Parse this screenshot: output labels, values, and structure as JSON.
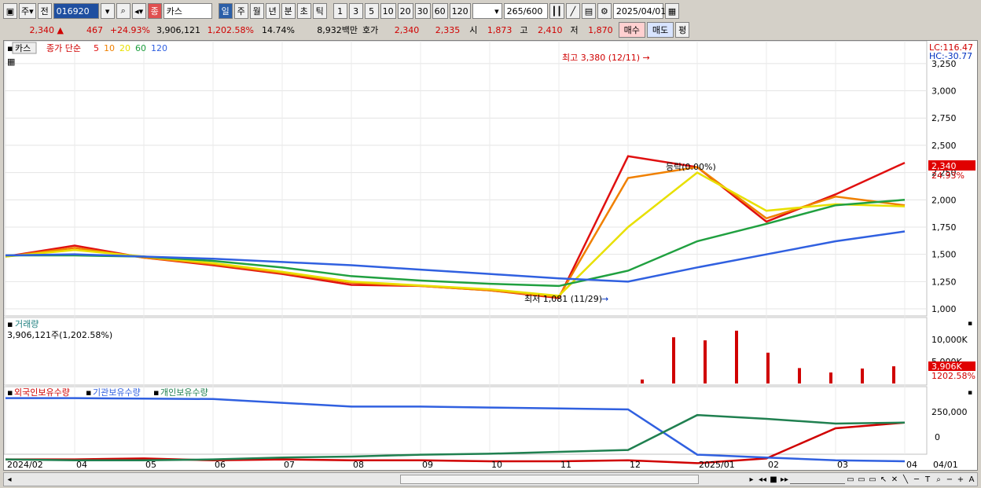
{
  "toolbar": {
    "menu1": "주",
    "menu2": "전",
    "code": "016920",
    "name_badge": "종",
    "name": "카스",
    "periods": [
      "일",
      "주",
      "월",
      "년",
      "분",
      "초",
      "틱"
    ],
    "intervals": [
      "1",
      "3",
      "5",
      "10",
      "20",
      "30",
      "60",
      "120"
    ],
    "count": "265",
    "count_max": "/600",
    "date": "2025/04/01"
  },
  "quote": {
    "price": "2,340",
    "change": "467",
    "change_pct": "+24.93%",
    "volume": "3,906,121",
    "vol_ratio": "1,202.58%",
    "turnover": "14.74%",
    "amount": "8,932백만",
    "hoga_label": "호가",
    "ask": "2,340",
    "bid": "2,335",
    "open_label": "시",
    "open": "1,873",
    "high_label": "고",
    "high": "2,410",
    "low_label": "저",
    "low": "1,870",
    "buy": "매수",
    "sell": "매도",
    "avg": "평"
  },
  "price_panel": {
    "name": "카스",
    "ma_label": "종가 단순",
    "ma": [
      {
        "p": "5",
        "c": "#e01010"
      },
      {
        "p": "10",
        "c": "#f08000"
      },
      {
        "p": "20",
        "c": "#e8e000"
      },
      {
        "p": "60",
        "c": "#20a040"
      },
      {
        "p": "120",
        "c": "#3060e0"
      }
    ],
    "high_note": "최고 3,380 (12/11) →",
    "low_note": "최저 1,081 (11/29)",
    "mid_note": "등락(0.00%)",
    "lc": "LC:116.47",
    "hc": "HC:-30.77",
    "last": "2,340",
    "last_pct": "24.93%",
    "yticks": [
      "3,250",
      "3,000",
      "2,750",
      "2,500",
      "2,250",
      "2,000",
      "1,750",
      "1,500",
      "1,250",
      "1,000"
    ]
  },
  "volume_panel": {
    "title": "거래량",
    "value": "3,906,121주(1,202.58%)",
    "yticks": [
      "10,000K",
      "5,000K"
    ],
    "last": "3,906K",
    "last_pct": "1202.58%"
  },
  "holding_panel": {
    "series": [
      {
        "name": "외국인보유수량",
        "color": "#d00000"
      },
      {
        "name": "기관보유수량",
        "color": "#3060e0"
      },
      {
        "name": "개인보유수량",
        "color": "#208050"
      }
    ],
    "yticks": [
      "250,000",
      "0"
    ]
  },
  "xaxis": [
    "2024/02",
    "04",
    "05",
    "06",
    "07",
    "08",
    "09",
    "10",
    "11",
    "12",
    "2025/01",
    "02",
    "03",
    "04",
    "04/01"
  ],
  "chart_data": {
    "type": "line",
    "title": "카스",
    "x": [
      "2024-02",
      "2024-04",
      "2024-05",
      "2024-06",
      "2024-07",
      "2024-08",
      "2024-09",
      "2024-10",
      "2024-11",
      "2024-12",
      "2025-01",
      "2025-02",
      "2025-03",
      "2025-04"
    ],
    "series": [
      {
        "name": "5",
        "values": [
          1480,
          1580,
          1470,
          1400,
          1320,
          1220,
          1210,
          1170,
          1100,
          2400,
          2300,
          1800,
          2050,
          2340
        ]
      },
      {
        "name": "10",
        "values": [
          1480,
          1560,
          1470,
          1410,
          1330,
          1240,
          1210,
          1170,
          1110,
          2200,
          2300,
          1830,
          2030,
          1950
        ]
      },
      {
        "name": "20",
        "values": [
          1480,
          1540,
          1480,
          1420,
          1340,
          1250,
          1215,
          1180,
          1120,
          1750,
          2250,
          1900,
          1960,
          1940
        ]
      },
      {
        "name": "60",
        "values": [
          1490,
          1490,
          1480,
          1440,
          1380,
          1300,
          1260,
          1230,
          1210,
          1350,
          1620,
          1780,
          1950,
          2000
        ]
      },
      {
        "name": "120",
        "values": [
          1490,
          1500,
          1480,
          1460,
          1430,
          1400,
          1360,
          1320,
          1280,
          1250,
          1380,
          1500,
          1620,
          1710
        ]
      }
    ],
    "ylim": [
      950,
      3400
    ],
    "volume": {
      "dates": [
        "12-05",
        "12-09",
        "12-10",
        "12-11",
        "12-12",
        "12-16",
        "01-02",
        "03-28",
        "04-01"
      ],
      "values": [
        900,
        10500,
        9800,
        12000,
        7000,
        3500,
        2500,
        3400,
        3906
      ]
    },
    "holdings": [
      {
        "name": "외국인보유수량",
        "values": [
          -230000,
          -230000,
          -220000,
          -240000,
          -230000,
          -240000,
          -240000,
          -250000,
          -250000,
          -240000,
          -270000,
          -220000,
          100000,
          160000
        ]
      },
      {
        "name": "기관보유수량",
        "values": [
          420000,
          420000,
          415000,
          410000,
          370000,
          330000,
          330000,
          320000,
          310000,
          300000,
          -180000,
          -210000,
          -240000,
          -250000
        ]
      },
      {
        "name": "개인보유수량",
        "values": [
          -230000,
          -240000,
          -240000,
          -230000,
          -210000,
          -200000,
          -180000,
          -170000,
          -150000,
          -130000,
          240000,
          200000,
          150000,
          160000
        ]
      }
    ]
  }
}
